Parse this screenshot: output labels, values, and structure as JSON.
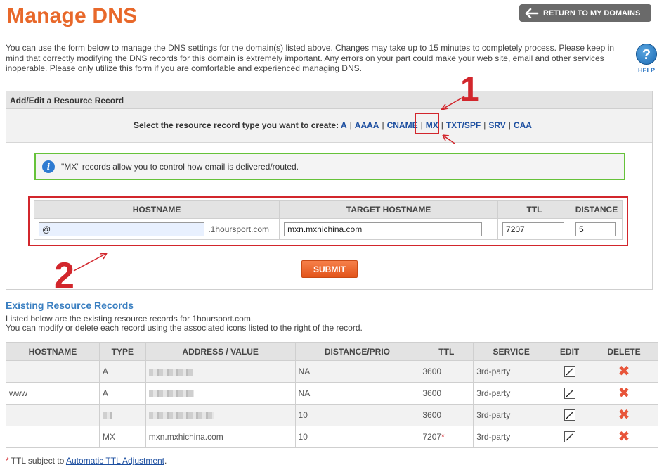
{
  "header": {
    "title": "Manage DNS",
    "return_label": "RETURN TO MY DOMAINS"
  },
  "intro": "You can use the form below to manage the DNS settings for the domain(s) listed above. Changes may take up to 15 minutes to completely process. Please keep in mind that correctly modifying the DNS records for this domain is extremely important. Any errors on your part could make your web site, email and other services inoperable. Please only utilize this form if you are comfortable and experienced managing DNS.",
  "help": {
    "icon": "?",
    "label": "HELP"
  },
  "panel": {
    "title": "Add/Edit a Resource Record",
    "type_prompt": "Select the resource record type you want to create:",
    "types": [
      "A",
      "AAAA",
      "CNAME",
      "MX",
      "TXT/SPF",
      "SRV",
      "CAA"
    ],
    "info_icon": "i",
    "info_text": "\"MX\" records allow you to control how email is delivered/routed.",
    "form_headers": [
      "HOSTNAME",
      "TARGET HOSTNAME",
      "TTL",
      "DISTANCE"
    ],
    "form": {
      "hostname": "@",
      "domain_suffix": ".1hoursport.com",
      "target": "mxn.mxhichina.com",
      "ttl": "7207",
      "distance": "5"
    },
    "submit_label": "SUBMIT"
  },
  "existing": {
    "title": "Existing Resource Records",
    "desc_line1": "Listed below are the existing resource records for 1hoursport.com.",
    "desc_line2": "You can modify or delete each record using the associated icons listed to the right of the record.",
    "headers": [
      "HOSTNAME",
      "TYPE",
      "ADDRESS / VALUE",
      "DISTANCE/PRIO",
      "TTL",
      "SERVICE",
      "EDIT",
      "DELETE"
    ],
    "rows": [
      {
        "host": "",
        "type": "A",
        "value": "",
        "distance": "NA",
        "ttl": "3600",
        "service": "3rd-party"
      },
      {
        "host": "www",
        "type": "A",
        "value": "",
        "distance": "NA",
        "ttl": "3600",
        "service": "3rd-party"
      },
      {
        "host": "",
        "type": "",
        "value": "",
        "distance": "10",
        "ttl": "3600",
        "service": "3rd-party"
      },
      {
        "host": "",
        "type": "MX",
        "value": "mxn.mxhichina.com",
        "distance": "10",
        "ttl": "7207",
        "service": "3rd-party"
      }
    ],
    "ttl_marker": "*"
  },
  "footnote": {
    "asterisk": "*",
    "text": "TTL subject to",
    "link": "Automatic TTL Adjustment",
    "end": "."
  },
  "annotations": {
    "one": "1",
    "two": "2"
  },
  "colors": {
    "accent": "#e8682a",
    "link": "#1d4fa0",
    "highlight_red": "#d2262c",
    "info_green": "#66c23a"
  }
}
